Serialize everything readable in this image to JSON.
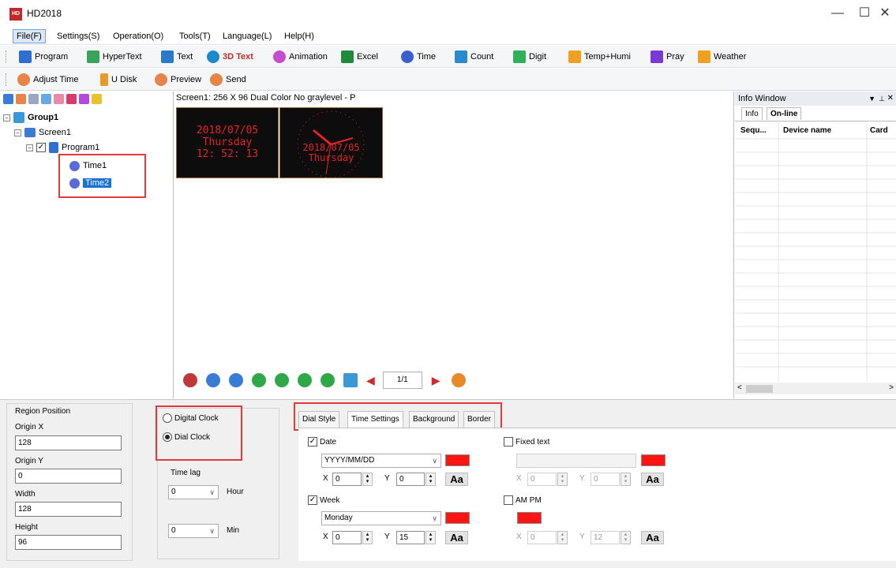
{
  "window": {
    "title": "HD2018",
    "minimize": "—",
    "maximize": "☐",
    "close": "✕"
  },
  "menu": [
    "File(F)",
    "Settings(S)",
    "Operation(O)",
    "Tools(T)",
    "Language(L)",
    "Help(H)"
  ],
  "toolbar1": [
    {
      "label": "Program",
      "icon": "program-icon",
      "color": "#2f6fd1"
    },
    {
      "label": "HyperText",
      "icon": "hypertext-icon",
      "color": "#3aa35a"
    },
    {
      "label": "Text",
      "icon": "text-icon",
      "color": "#2b79c9"
    },
    {
      "label": "3D Text",
      "icon": "3d-text-icon",
      "color": "#1d8acb"
    },
    {
      "label": "Animation",
      "icon": "animation-icon",
      "color": "#c64dd0"
    },
    {
      "label": "Excel",
      "icon": "excel-icon",
      "color": "#1f8a3a"
    },
    {
      "label": "Time",
      "icon": "time-icon",
      "color": "#3a5fd1"
    },
    {
      "label": "Count",
      "icon": "count-icon",
      "color": "#2b8ac9"
    },
    {
      "label": "Digit",
      "icon": "digit-icon",
      "color": "#2fb05a"
    },
    {
      "label": "Temp+Humi",
      "icon": "thermometer-icon",
      "color": "#f0a020"
    },
    {
      "label": "Pray",
      "icon": "pray-icon",
      "color": "#7a3ad1"
    },
    {
      "label": "Weather",
      "icon": "weather-icon",
      "color": "#f0a020"
    }
  ],
  "toolbar2": [
    {
      "label": "Adjust Time",
      "icon": "adjust-time-icon",
      "color": "#e8834a"
    },
    {
      "label": "U Disk",
      "icon": "u-disk-icon",
      "color": "#e89a2a"
    },
    {
      "label": "Preview",
      "icon": "preview-icon",
      "color": "#e8834a"
    },
    {
      "label": "Send",
      "icon": "send-icon",
      "color": "#e8834a"
    }
  ],
  "tree": {
    "group": "Group1",
    "screen": "Screen1",
    "program": "Program1",
    "items": [
      "Time1",
      "Time2"
    ]
  },
  "canvas": {
    "header": "Screen1: 256 X 96  Dual Color No graylevel - P",
    "digital": {
      "date": "2018/07/05",
      "weekday": "Thursday",
      "time": "12: 52: 13"
    },
    "dial": {
      "date": "2018/07/05",
      "weekday": "Thursday"
    },
    "page": "1/1"
  },
  "info_window": {
    "title": "Info Window",
    "tabs": [
      "Info",
      "On-line"
    ],
    "columns": [
      "Sequ...",
      "Device name",
      "Card"
    ]
  },
  "region": {
    "title": "Region Position",
    "origin_x_label": "Origin X",
    "origin_x": "128",
    "origin_y_label": "Origin Y",
    "origin_y": "0",
    "width_label": "Width",
    "width": "128",
    "height_label": "Height",
    "height": "96"
  },
  "clock_type": {
    "digital": "Digital Clock",
    "dial": "Dial Clock",
    "selected": "dial",
    "time_lag": "Time lag",
    "hour_value": "0",
    "hour_unit": "Hour",
    "min_value": "0",
    "min_unit": "Min"
  },
  "settings_tabs": [
    "Dial Style",
    "Time Settings",
    "Background",
    "Border"
  ],
  "time_settings": {
    "date_label": "Date",
    "date_checked": true,
    "date_format": "YYYY/MM/DD",
    "date_x": "0",
    "date_y": "0",
    "week_label": "Week",
    "week_checked": true,
    "week_format": "Monday",
    "week_x": "0",
    "week_y": "15",
    "fixed_label": "Fixed text",
    "fixed_checked": false,
    "fixed_x": "0",
    "fixed_y": "0",
    "ampm_label": "AM PM",
    "ampm_checked": false,
    "ampm_x": "0",
    "ampm_y": "12",
    "x_label": "X",
    "y_label": "Y",
    "font_button": "Aa"
  }
}
